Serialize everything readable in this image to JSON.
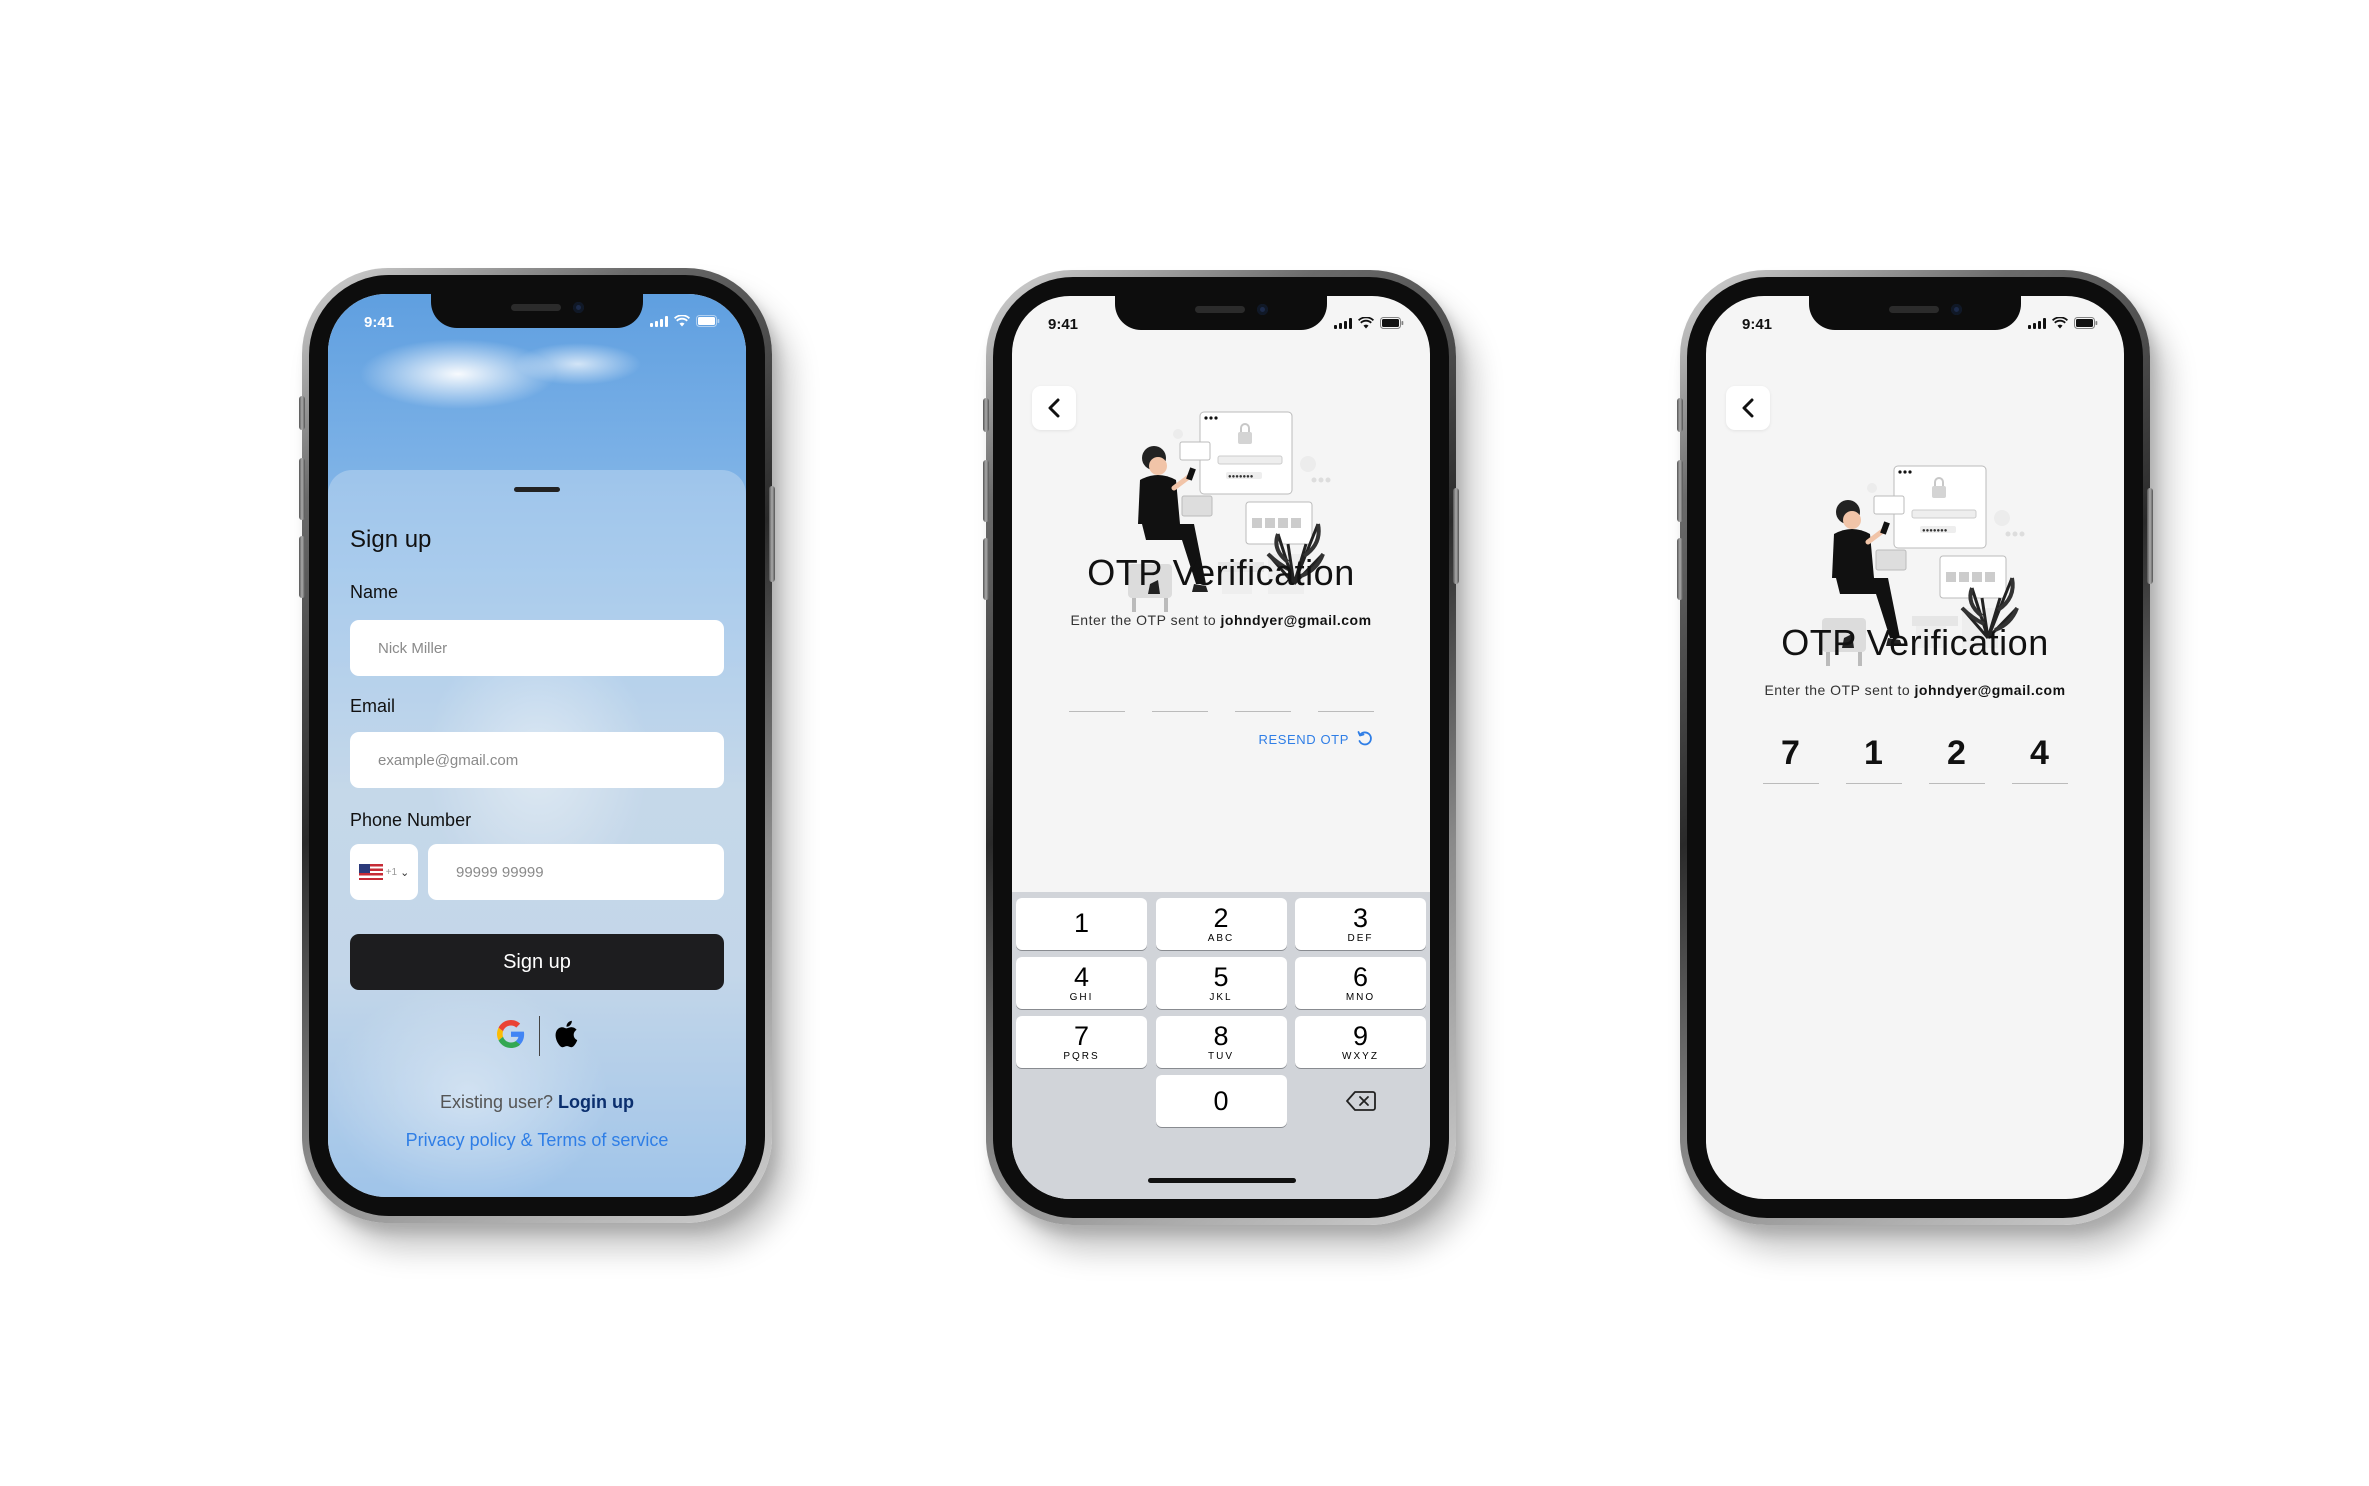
{
  "status": {
    "time": "9:41"
  },
  "signup": {
    "title": "Sign up",
    "name_label": "Name",
    "name_placeholder": "Nick Miller",
    "email_label": "Email",
    "email_placeholder": "example@gmail.com",
    "phone_label": "Phone Number",
    "country_code": "+1",
    "phone_placeholder": "99999 99999",
    "submit_label": "Sign up",
    "existing_prompt": "Existing user?",
    "login_label": "Login up",
    "legal_label": "Privacy policy & Terms of service"
  },
  "otp_entry": {
    "title": "OTP Verification",
    "subtitle_prefix": "Enter the OTP sent to",
    "email": "johndyer@gmail.com",
    "resend_label": "RESEND OTP",
    "digits": [
      "",
      "",
      "",
      ""
    ]
  },
  "otp_filled": {
    "title": "OTP Verification",
    "subtitle_prefix": "Enter the OTP sent to",
    "email": "johndyer@gmail.com",
    "digits": [
      "7",
      "1",
      "2",
      "4"
    ]
  },
  "keypad": {
    "keys": [
      {
        "num": "1",
        "letters": ""
      },
      {
        "num": "2",
        "letters": "ABC"
      },
      {
        "num": "3",
        "letters": "DEF"
      },
      {
        "num": "4",
        "letters": "GHI"
      },
      {
        "num": "5",
        "letters": "JKL"
      },
      {
        "num": "6",
        "letters": "MNO"
      },
      {
        "num": "7",
        "letters": "PQRS"
      },
      {
        "num": "8",
        "letters": "TUV"
      },
      {
        "num": "9",
        "letters": "WXYZ"
      },
      {
        "num": "0",
        "letters": ""
      }
    ]
  },
  "icons": {
    "back": "chevron-left-icon",
    "google": "google-icon",
    "apple": "apple-icon",
    "resend": "refresh-icon",
    "delete": "backspace-icon"
  },
  "colors": {
    "primary_button": "#1d1d1f",
    "link_dark": "#0b2f6e",
    "link_blue": "#2f7ee6",
    "keypad_bg": "#d1d4d9"
  }
}
